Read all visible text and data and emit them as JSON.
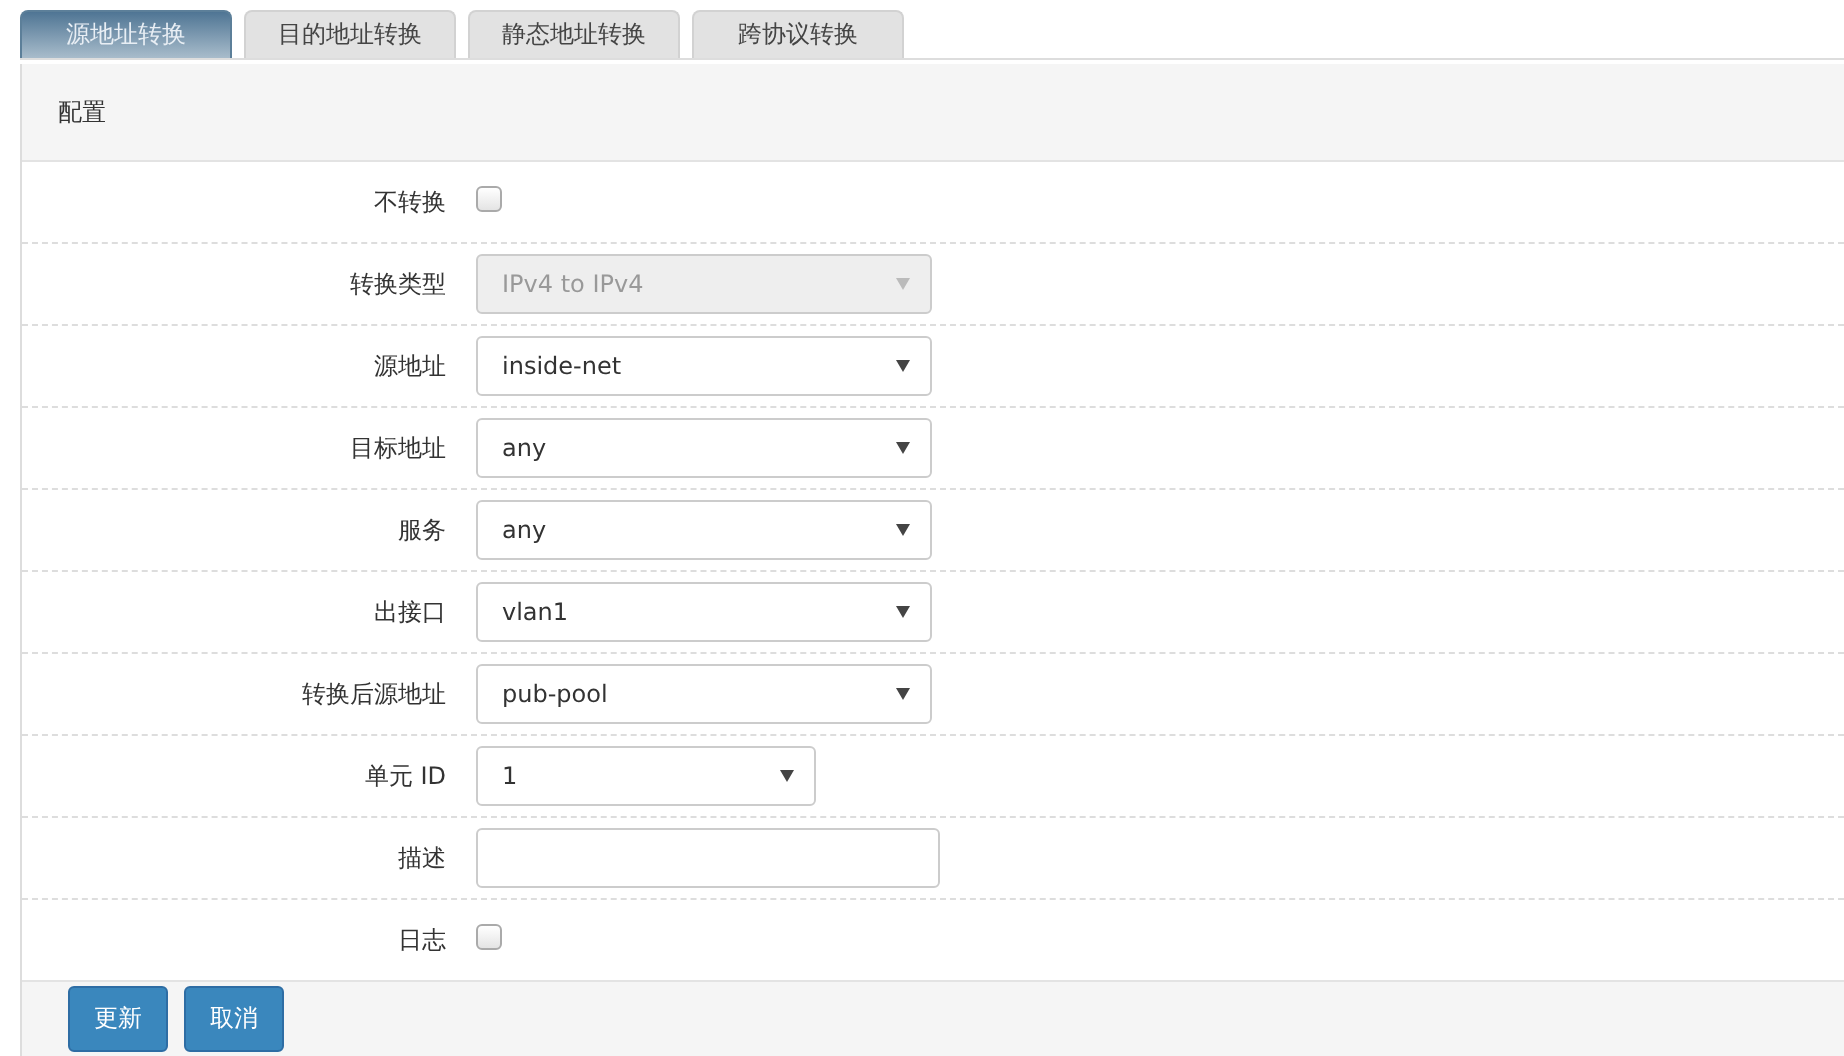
{
  "tabs": [
    {
      "label": "源地址转换",
      "selected": true
    },
    {
      "label": "目的地址转换",
      "selected": false
    },
    {
      "label": "静态地址转换",
      "selected": false
    },
    {
      "label": "跨协议转换",
      "selected": false
    }
  ],
  "panel": {
    "title": "配置"
  },
  "fields": [
    {
      "label": "不转换",
      "kind": "checkbox",
      "checked": false
    },
    {
      "label": "转换类型",
      "kind": "select",
      "value": "IPv4 to IPv4",
      "disabled": true
    },
    {
      "label": "源地址",
      "kind": "select",
      "value": "inside-net",
      "disabled": false
    },
    {
      "label": "目标地址",
      "kind": "select",
      "value": "any",
      "disabled": false
    },
    {
      "label": "服务",
      "kind": "select",
      "value": "any",
      "disabled": false
    },
    {
      "label": "出接口",
      "kind": "select",
      "value": "vlan1",
      "disabled": false
    },
    {
      "label": "转换后源地址",
      "kind": "select",
      "value": "pub-pool",
      "disabled": false
    },
    {
      "label": "单元 ID",
      "kind": "compact-select",
      "value": "1",
      "disabled": false
    },
    {
      "label": "描述",
      "kind": "input"
    },
    {
      "label": "日志",
      "kind": "checkbox",
      "checked": false
    }
  ],
  "buttons": [
    "更新",
    "取消"
  ]
}
